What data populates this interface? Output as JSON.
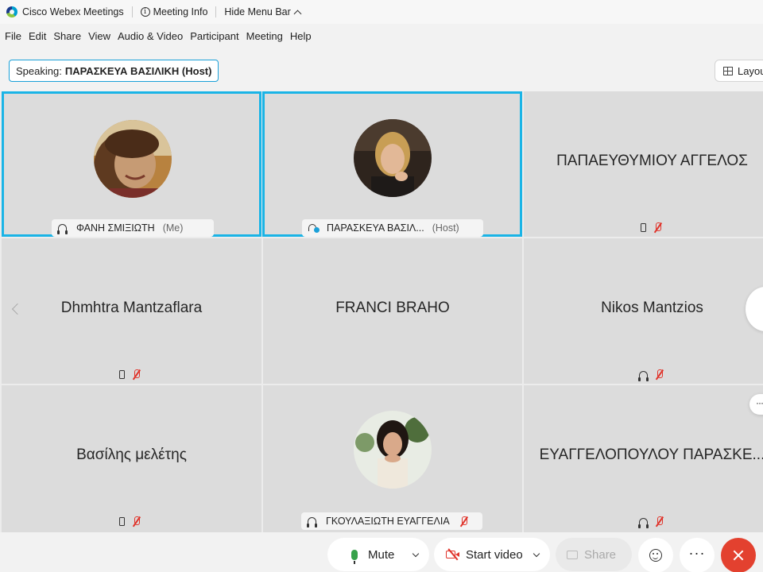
{
  "titlebar": {
    "app_name": "Cisco Webex Meetings",
    "meeting_info": "Meeting Info",
    "hide_menu_bar": "Hide Menu Bar"
  },
  "menu": {
    "file": "File",
    "edit": "Edit",
    "share": "Share",
    "view": "View",
    "audio_video": "Audio & Video",
    "participant": "Participant",
    "meeting": "Meeting",
    "help": "Help"
  },
  "speaking": {
    "label": "Speaking:",
    "name": "ΠΑΡΑΣΚΕΥΑ ΒΑΣΙΛΙΚΗ (Host)"
  },
  "layout_button": {
    "label": "Layout"
  },
  "participants": {
    "p1": {
      "name": "ΦΑΝΗ ΣΜΙΞΙΩΤΗ",
      "role": "(Me)"
    },
    "p2": {
      "name": "ΠΑΡΑΣΚΕΥΑ ΒΑΣΙΛ...",
      "role": "(Host)"
    },
    "p3": {
      "name": "ΠΑΠΑΕΥΘΥΜΙΟΥ ΑΓΓΕΛΟΣ"
    },
    "p4": {
      "name": "Dhmhtra Mantzaflara"
    },
    "p5": {
      "name": "FRANCI BRAHO"
    },
    "p6": {
      "name": "Nikos Mantzios"
    },
    "p7": {
      "name": "Βασίλης μελέτης"
    },
    "p8": {
      "name": "ΓΚΟΥΛΑΞΙΩΤΗ ΕΥΑΓΓΕΛΙΑ"
    },
    "p9": {
      "name": "ΕΥΑΓΓΕΛΟΠΟΥΛΟΥ ΠΑΡΑΣΚΕ..."
    }
  },
  "controls": {
    "mute": "Mute",
    "start_video": "Start video",
    "share": "Share"
  },
  "colors": {
    "active_border": "#1ab4e6",
    "end_meeting": "#e3412f",
    "muted_red": "#e0342b",
    "mic_green": "#37a24a"
  }
}
